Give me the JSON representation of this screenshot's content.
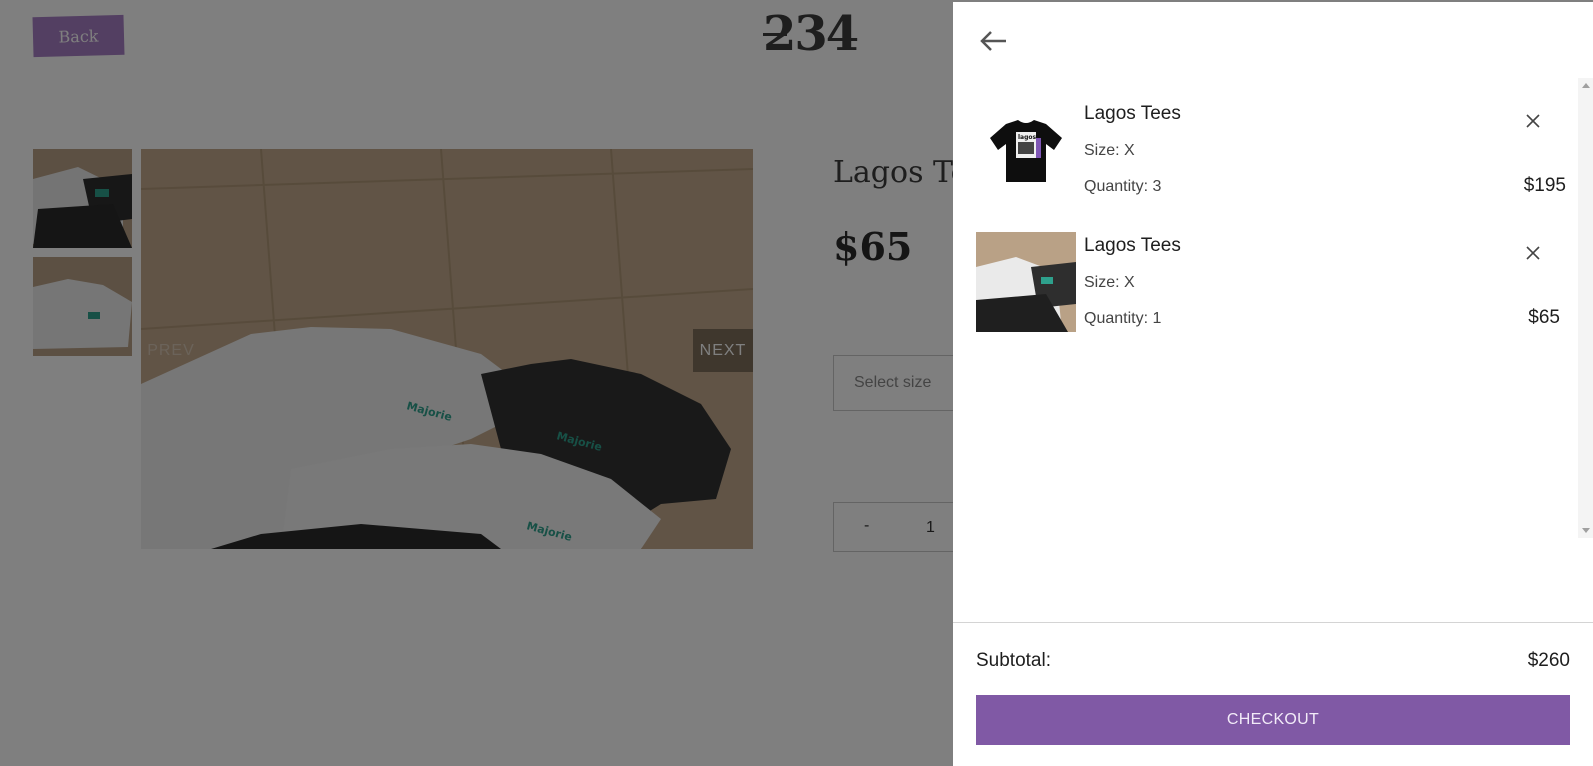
{
  "page": {
    "back_label": "Back",
    "logo_text": "234",
    "product_title": "Lagos Tees",
    "product_price": "$65",
    "gallery": {
      "prev_label": "PREV",
      "next_label": "NEXT"
    },
    "size_placeholder": "Select size",
    "quantity": {
      "minus_label": "-",
      "value": "1"
    }
  },
  "cart": {
    "items": [
      {
        "name": "Lagos Tees",
        "size": "Size: X",
        "quantity": "Quantity: 3",
        "price": "$195",
        "image_icon": "black-tshirt-image"
      },
      {
        "name": "Lagos Tees",
        "size": "Size: X",
        "quantity": "Quantity: 1",
        "price": "$65",
        "image_icon": "tshirts-on-floor-image"
      }
    ],
    "subtotal_label": "Subtotal:",
    "subtotal_value": "$260",
    "checkout_label": "CHECKOUT"
  },
  "colors": {
    "accent": "#8059a5",
    "back_button": "#a77fc4",
    "overlay": "rgba(0,0,0,0.5)"
  }
}
